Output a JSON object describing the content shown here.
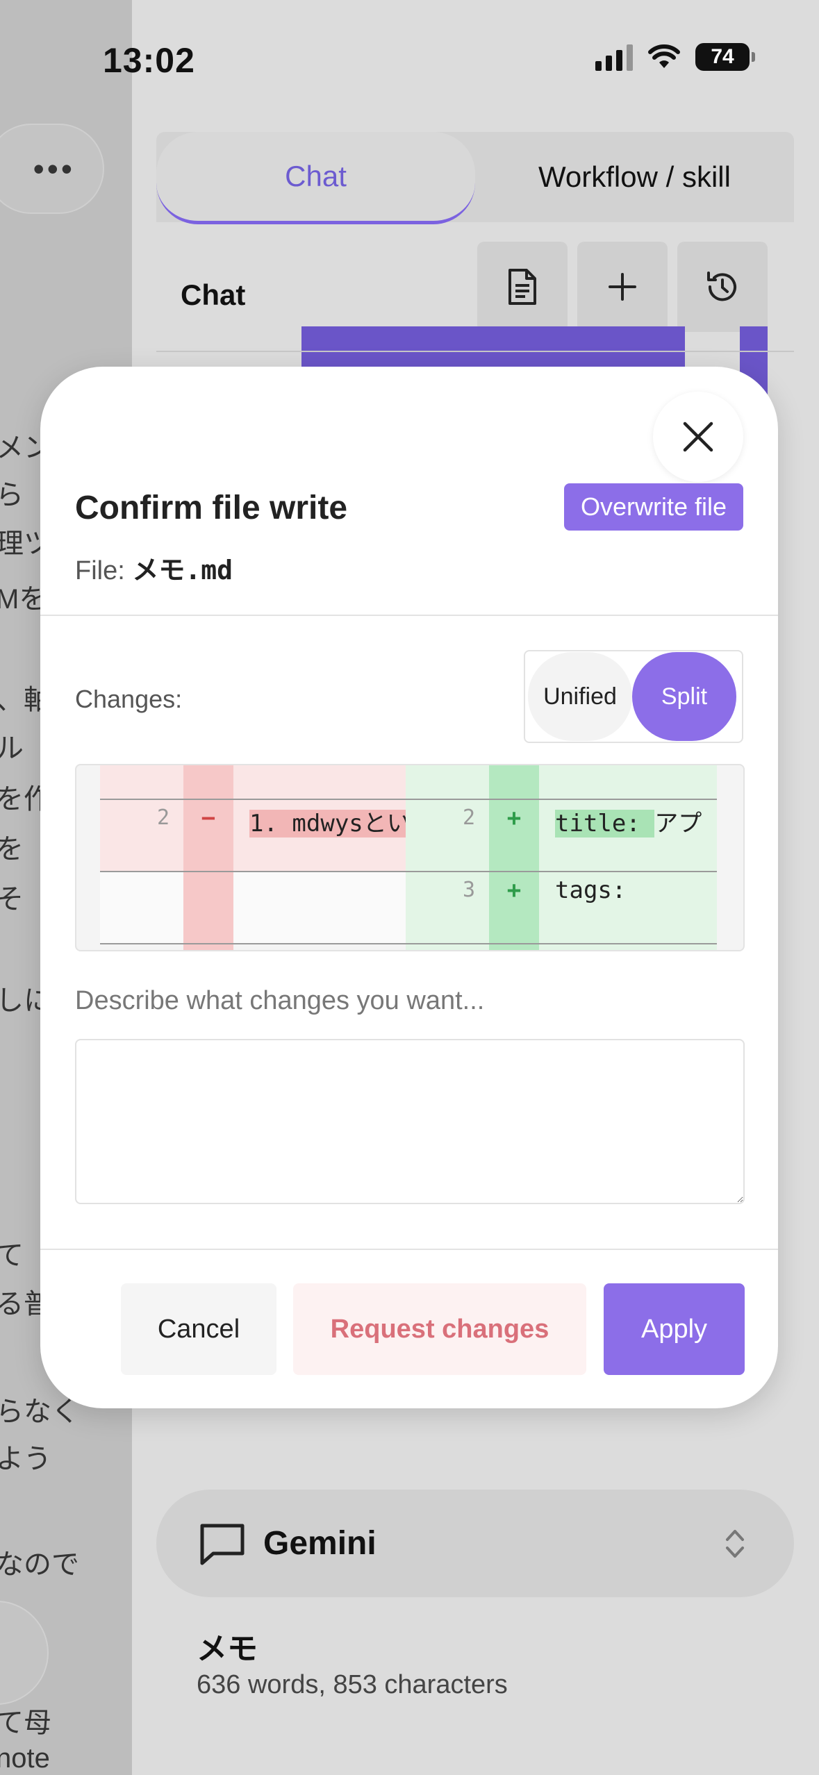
{
  "status_bar": {
    "time": "13:02",
    "battery": "74"
  },
  "left_pane": {
    "more_label": "•••",
    "text_lines": [
      "メン",
      "ら",
      "理ツ",
      "Mを",
      "、軸",
      "ル",
      "を作",
      "を",
      "そ",
      "しに",
      "て",
      "る普",
      "らなく",
      "よう",
      "なので",
      "て母",
      "note"
    ]
  },
  "tabs": {
    "chat": "Chat",
    "workflow": "Workflow / skill"
  },
  "chat_header": {
    "title": "Chat"
  },
  "modal": {
    "title": "Confirm file write",
    "overwrite_label": "Overwrite file",
    "file_prefix": "File: ",
    "file_name": "メモ.md",
    "changes_label": "Changes:",
    "view_modes": {
      "unified": "Unified",
      "split": "Split"
    },
    "selected_view_mode": "Split",
    "diff": {
      "left": [
        {
          "line": "2",
          "sign": "−",
          "code": "1. mdwysとい"
        }
      ],
      "right": [
        {
          "line": "2",
          "sign": "+",
          "code_highlight": "title: ",
          "code_rest": "アプ"
        },
        {
          "line": "3",
          "sign": "+",
          "code": "tags:"
        }
      ]
    },
    "describe_placeholder": "Describe what changes you want...",
    "buttons": {
      "cancel": "Cancel",
      "request": "Request changes",
      "apply": "Apply"
    }
  },
  "model_selector": {
    "label": "Gemini"
  },
  "document": {
    "title": "メモ",
    "stats": "636 words, 853 characters"
  },
  "colors": {
    "accent": "#8c6ee8",
    "danger_text": "#d9707a",
    "add_bg": "#e3f5e6",
    "del_bg": "#fae6e6"
  }
}
